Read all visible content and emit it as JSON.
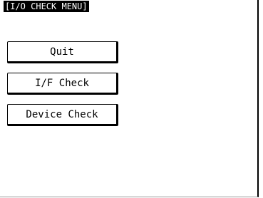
{
  "header": {
    "title": "[I/O CHECK MENU]"
  },
  "menu": {
    "items": [
      {
        "label": "Quit"
      },
      {
        "label": "I/F Check"
      },
      {
        "label": "Device Check"
      }
    ]
  }
}
